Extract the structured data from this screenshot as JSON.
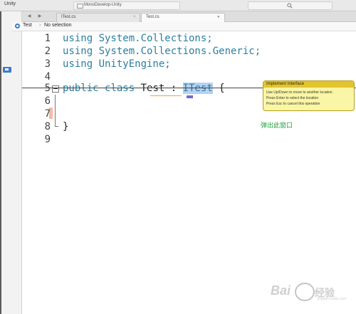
{
  "app": {
    "title": "Unity",
    "window_title": "MonoDevelop-Unity"
  },
  "tabs": [
    {
      "label": "ITest.cs",
      "active": false
    },
    {
      "label": "Test.cs",
      "active": true
    }
  ],
  "breadcrumb": {
    "class": "Test",
    "member": "No selection"
  },
  "editor": {
    "lines": [
      {
        "no": "1",
        "text": "using System.Collections;"
      },
      {
        "no": "2",
        "text": "using System.Collections.Generic;"
      },
      {
        "no": "3",
        "text": "using UnityEngine;"
      },
      {
        "no": "4",
        "text": ""
      },
      {
        "no": "5",
        "kw1": "public",
        "kw2": "class",
        "name": "Test",
        "colon": ":",
        "iface": "ITest",
        "brace": "{"
      },
      {
        "no": "6",
        "text": ""
      },
      {
        "no": "7",
        "text": ""
      },
      {
        "no": "8",
        "text": "}"
      },
      {
        "no": "9",
        "text": ""
      }
    ]
  },
  "tooltip": {
    "title": "Implement Interface",
    "lines": [
      "Use Up/Down to move to another location.",
      "Press Enter to select the location",
      "Press Esc to cancel this operation"
    ]
  },
  "annotation": "弹出此窗口",
  "watermark": {
    "brand": "Bai",
    "brand_cn": "经验",
    "sub": "jingyan.baidu.com"
  },
  "colors": {
    "keyword": "#2a7fa0",
    "selection": "#b7d1f2",
    "tooltip_bg": "#fbf6a5",
    "tooltip_header": "#e3c42e",
    "annotation": "#1fa33c"
  }
}
